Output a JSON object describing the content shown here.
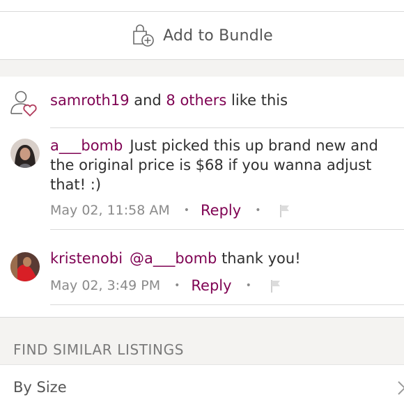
{
  "bundle": {
    "label": "Add to Bundle",
    "icon": "bag-plus-icon"
  },
  "likes": {
    "icon": "user-heart-icon",
    "user": "samroth19",
    "and": " and ",
    "others": "8 others",
    "suffix": " like this"
  },
  "comments": [
    {
      "username": "a___bomb",
      "text": "Just picked this up brand new and the original price is $68 if you wanna adjust that! :)",
      "timestamp": "May 02, 11:58 AM",
      "reply_label": "Reply",
      "dot": "•"
    },
    {
      "username": "kristenobi",
      "mention": "@a___bomb",
      "text": " thank you!",
      "timestamp": "May 02, 3:49 PM",
      "reply_label": "Reply",
      "dot": "•"
    }
  ],
  "similar": {
    "title": "FIND SIMILAR LISTINGS",
    "rows": [
      {
        "label": "By Size"
      }
    ]
  },
  "colors": {
    "accent": "#7f0353",
    "text": "#2f2f2f",
    "muted": "#8a8a8a",
    "band": "#f4f3f1"
  }
}
